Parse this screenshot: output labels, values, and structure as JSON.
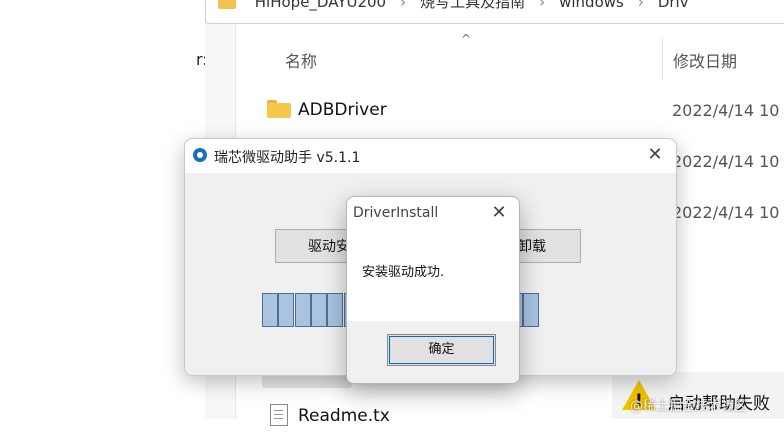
{
  "explorer": {
    "left_partial_text": "r:",
    "address_segments": [
      "HiHope_DAYU200",
      "烧写工具及指南",
      "windows",
      "Driv"
    ],
    "columns": {
      "name": "名称",
      "date": "修改日期"
    },
    "rows": [
      {
        "name": "ADBDriver",
        "date": "2022/4/14 10",
        "icon": "folder-icon"
      },
      {
        "name": "",
        "date": "2022/4/14 10",
        "icon": "folder-icon"
      },
      {
        "name": "",
        "date": "2022/4/14 10",
        "icon": "folder-icon"
      },
      {
        "name": "Readme.tx",
        "date": "",
        "icon": "text-file-icon"
      }
    ],
    "notification": {
      "text": "启动帮助失败",
      "icon": "warning-icon"
    },
    "watermark": "@稀土掘金技术社区"
  },
  "app": {
    "title": "瑞芯微驱动助手 v5.1.1",
    "install_label": "驱动安",
    "uninstall_label": "卸载",
    "progress_segments_visible": 17
  },
  "dialog": {
    "title": "DriverInstall",
    "message": "安装驱动成功.",
    "ok_label": "确定"
  },
  "colors": {
    "progress_fill": "#a9c3e0",
    "progress_border": "#4d6f96",
    "folder": "#f5c84a",
    "warning": "#f2c200",
    "focus_outline": "#0f67c4"
  }
}
